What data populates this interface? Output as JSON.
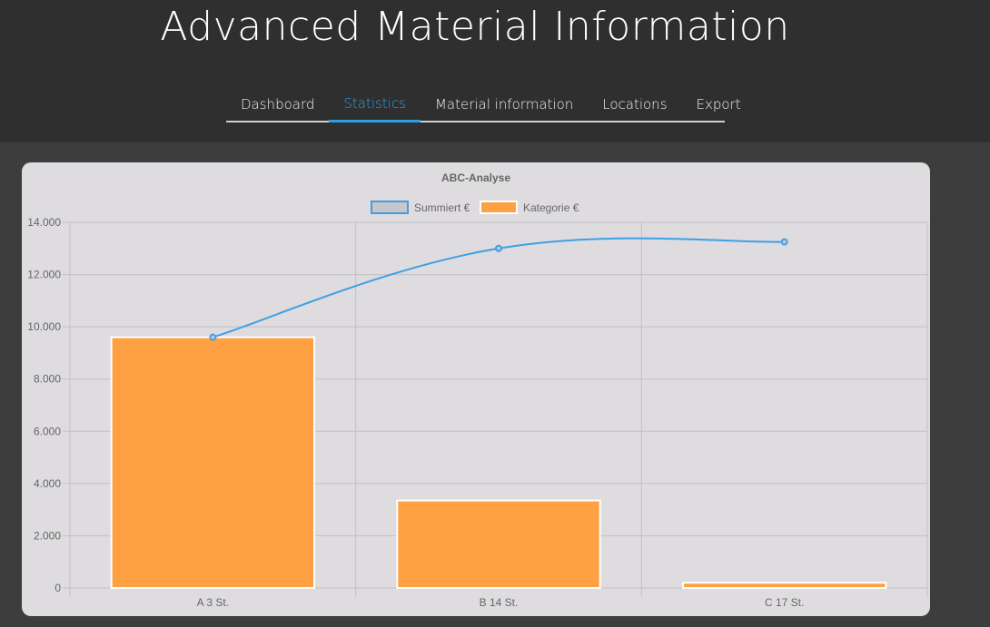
{
  "app": {
    "title": "Advanced Material Information"
  },
  "nav": {
    "tabs": [
      {
        "label": "Dashboard",
        "active": false
      },
      {
        "label": "Statistics",
        "active": true
      },
      {
        "label": "Material information",
        "active": false
      },
      {
        "label": "Locations",
        "active": false
      },
      {
        "label": "Export",
        "active": false
      }
    ]
  },
  "colors": {
    "accent": "#2f9fe3",
    "bar_fill": "#ffa043",
    "line": "#3ea0e4",
    "card_bg": "#dedcdf",
    "header_bg": "#2f2f2f"
  },
  "chart_data": {
    "type": "bar",
    "title": "ABC-Analyse",
    "categories": [
      "A 3 St.",
      "B 14 St.",
      "C 17 St."
    ],
    "ylim": [
      0,
      14000
    ],
    "yticks": [
      0,
      2000,
      4000,
      6000,
      8000,
      10000,
      12000,
      14000
    ],
    "ytick_labels": [
      "0",
      "2.000",
      "4.000",
      "6.000",
      "8.000",
      "10.000",
      "12.000",
      "14.000"
    ],
    "grid": true,
    "legend_position": "top",
    "series": [
      {
        "name": "Summiert €",
        "type": "line",
        "color": "#3ea0e4",
        "values": [
          9600,
          13000,
          13250
        ]
      },
      {
        "name": "Kategorie €",
        "type": "bar",
        "color": "#ffa043",
        "values": [
          9600,
          3350,
          200
        ]
      }
    ]
  }
}
